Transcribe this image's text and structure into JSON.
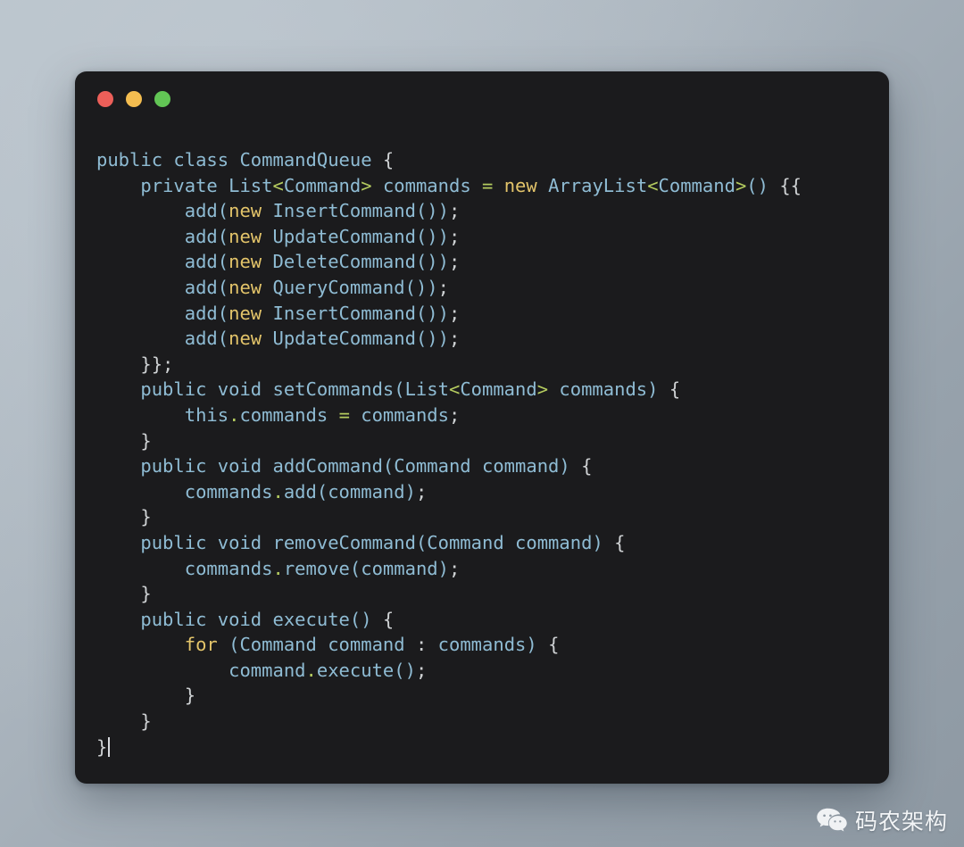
{
  "window": {
    "controls": [
      {
        "name": "close",
        "color": "#ec5f59",
        "label": "Close"
      },
      {
        "name": "minimize",
        "color": "#f4bd50",
        "label": "Minimize"
      },
      {
        "name": "maximize",
        "color": "#62c555",
        "label": "Maximize"
      }
    ],
    "background": "#1b1b1d"
  },
  "editor": {
    "language": "java",
    "caret_visible": true,
    "colors": {
      "default": "#8fbcd4",
      "keyword": "#e3c46a",
      "operator": "#b5cc5f",
      "punctuation": "#cfd2d4",
      "background": "#1b1b1d"
    },
    "lines": [
      "public class CommandQueue {",
      "    private List<Command> commands = new ArrayList<Command>() {{",
      "        add(new InsertCommand());",
      "        add(new UpdateCommand());",
      "        add(new DeleteCommand());",
      "        add(new QueryCommand());",
      "        add(new InsertCommand());",
      "        add(new UpdateCommand());",
      "    }};",
      "    public void setCommands(List<Command> commands) {",
      "        this.commands = commands;",
      "    }",
      "    public void addCommand(Command command) {",
      "        commands.add(command);",
      "    }",
      "    public void removeCommand(Command command) {",
      "        commands.remove(command);",
      "    }",
      "    public void execute() {",
      "        for (Command command : commands) {",
      "            command.execute();",
      "        }",
      "    }",
      "}"
    ],
    "code_html": "<span class=\"tok-mod\">public class</span> <span class=\"tok-type\">CommandQueue</span> <span class=\"tok-punct\">{</span>\n    <span class=\"tok-mod\">private</span> <span class=\"tok-type\">List</span><span class=\"tok-op\">&lt;</span><span class=\"tok-type\">Command</span><span class=\"tok-op\">&gt;</span> <span class=\"tok-ident\">commands</span> <span class=\"tok-op\">=</span> <span class=\"tok-kw\">new</span> <span class=\"tok-type\">ArrayList</span><span class=\"tok-op\">&lt;</span><span class=\"tok-type\">Command</span><span class=\"tok-op\">&gt;</span><span class=\"tok-paren\">()</span> <span class=\"tok-punct\">{{</span>\n        <span class=\"tok-ident\">add</span><span class=\"tok-paren\">(</span><span class=\"tok-kw\">new</span> <span class=\"tok-type\">InsertCommand</span><span class=\"tok-paren\">())</span><span class=\"tok-punct\">;</span>\n        <span class=\"tok-ident\">add</span><span class=\"tok-paren\">(</span><span class=\"tok-kw\">new</span> <span class=\"tok-type\">UpdateCommand</span><span class=\"tok-paren\">())</span><span class=\"tok-punct\">;</span>\n        <span class=\"tok-ident\">add</span><span class=\"tok-paren\">(</span><span class=\"tok-kw\">new</span> <span class=\"tok-type\">DeleteCommand</span><span class=\"tok-paren\">())</span><span class=\"tok-punct\">;</span>\n        <span class=\"tok-ident\">add</span><span class=\"tok-paren\">(</span><span class=\"tok-kw\">new</span> <span class=\"tok-type\">QueryCommand</span><span class=\"tok-paren\">())</span><span class=\"tok-punct\">;</span>\n        <span class=\"tok-ident\">add</span><span class=\"tok-paren\">(</span><span class=\"tok-kw\">new</span> <span class=\"tok-type\">InsertCommand</span><span class=\"tok-paren\">())</span><span class=\"tok-punct\">;</span>\n        <span class=\"tok-ident\">add</span><span class=\"tok-paren\">(</span><span class=\"tok-kw\">new</span> <span class=\"tok-type\">UpdateCommand</span><span class=\"tok-paren\">())</span><span class=\"tok-punct\">;</span>\n    <span class=\"tok-punct\">}};</span>\n    <span class=\"tok-mod\">public void</span> <span class=\"tok-ident\">setCommands</span><span class=\"tok-paren\">(</span><span class=\"tok-type\">List</span><span class=\"tok-op\">&lt;</span><span class=\"tok-type\">Command</span><span class=\"tok-op\">&gt;</span> <span class=\"tok-ident\">commands</span><span class=\"tok-paren\">)</span> <span class=\"tok-punct\">{</span>\n        <span class=\"tok-ident\">this</span><span class=\"tok-op\">.</span><span class=\"tok-ident\">commands</span> <span class=\"tok-op\">=</span> <span class=\"tok-ident\">commands</span><span class=\"tok-punct\">;</span>\n    <span class=\"tok-punct\">}</span>\n    <span class=\"tok-mod\">public void</span> <span class=\"tok-ident\">addCommand</span><span class=\"tok-paren\">(</span><span class=\"tok-type\">Command</span> <span class=\"tok-ident\">command</span><span class=\"tok-paren\">)</span> <span class=\"tok-punct\">{</span>\n        <span class=\"tok-ident\">commands</span><span class=\"tok-op\">.</span><span class=\"tok-ident\">add</span><span class=\"tok-paren\">(</span><span class=\"tok-ident\">command</span><span class=\"tok-paren\">)</span><span class=\"tok-punct\">;</span>\n    <span class=\"tok-punct\">}</span>\n    <span class=\"tok-mod\">public void</span> <span class=\"tok-ident\">removeCommand</span><span class=\"tok-paren\">(</span><span class=\"tok-type\">Command</span> <span class=\"tok-ident\">command</span><span class=\"tok-paren\">)</span> <span class=\"tok-punct\">{</span>\n        <span class=\"tok-ident\">commands</span><span class=\"tok-op\">.</span><span class=\"tok-ident\">remove</span><span class=\"tok-paren\">(</span><span class=\"tok-ident\">command</span><span class=\"tok-paren\">)</span><span class=\"tok-punct\">;</span>\n    <span class=\"tok-punct\">}</span>\n    <span class=\"tok-mod\">public void</span> <span class=\"tok-ident\">execute</span><span class=\"tok-paren\">()</span> <span class=\"tok-punct\">{</span>\n        <span class=\"tok-kw\">for</span> <span class=\"tok-paren\">(</span><span class=\"tok-type\">Command</span> <span class=\"tok-ident\">command</span> <span class=\"tok-punct\">:</span> <span class=\"tok-ident\">commands</span><span class=\"tok-paren\">)</span> <span class=\"tok-punct\">{</span>\n            <span class=\"tok-ident\">command</span><span class=\"tok-op\">.</span><span class=\"tok-ident\">execute</span><span class=\"tok-paren\">()</span><span class=\"tok-punct\">;</span>\n        <span class=\"tok-punct\">}</span>\n    <span class=\"tok-punct\">}</span>\n<span class=\"tok-punct\">}</span><span class=\"caret\"></span>"
  },
  "watermark": {
    "text": "码农架构",
    "icon": "wechat-icon",
    "color": "#f2f4f6"
  }
}
